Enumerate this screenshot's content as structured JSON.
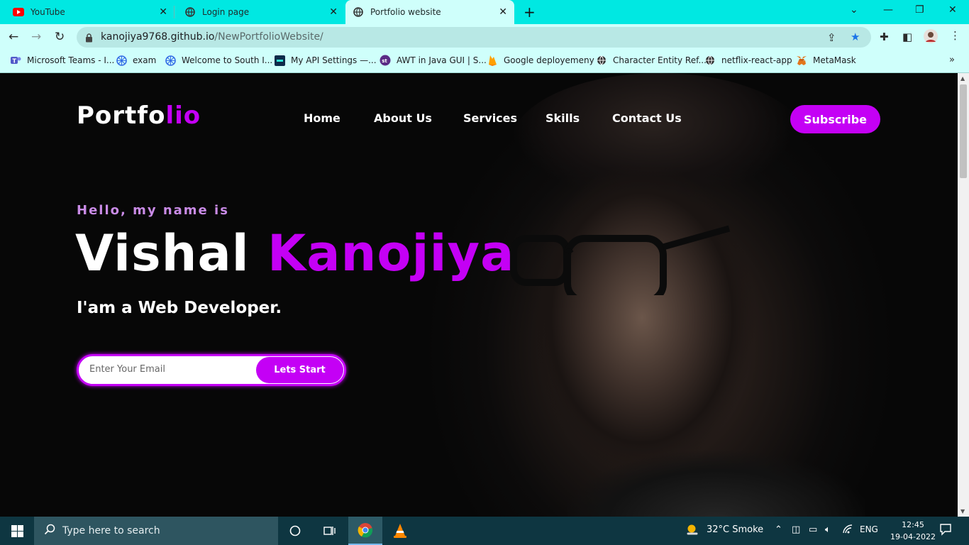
{
  "browser": {
    "tabs": [
      {
        "title": "YouTube",
        "icon": "youtube-icon"
      },
      {
        "title": "Login page",
        "icon": "globe-icon"
      },
      {
        "title": "Portfolio website",
        "icon": "globe-icon",
        "active": true
      }
    ],
    "url_host": "kanojiya9768.github.io",
    "url_path": "/NewPortfolioWebsite/",
    "bookmarks": [
      {
        "label": "Microsoft Teams - I...",
        "icon": "teams-icon"
      },
      {
        "label": "exam",
        "icon": "kubernetes-icon"
      },
      {
        "label": "Welcome to South I...",
        "icon": "kubernetes-icon"
      },
      {
        "label": "My API Settings —...",
        "icon": "api-icon"
      },
      {
        "label": "AWT in Java GUI | S...",
        "icon": "st-icon"
      },
      {
        "label": "Google deployemeny",
        "icon": "firebase-icon"
      },
      {
        "label": "Character Entity Ref...",
        "icon": "globe-icon"
      },
      {
        "label": "netflix-react-app",
        "icon": "globe-icon"
      },
      {
        "label": "MetaMask",
        "icon": "metamask-icon"
      }
    ]
  },
  "site": {
    "logo_main": "Portfo",
    "logo_accent": "lio",
    "nav": [
      "Home",
      "About Us",
      "Services",
      "Skills",
      "Contact Us"
    ],
    "subscribe": "Subscribe",
    "hello": "Hello, my name is",
    "first_name": "Vishal",
    "last_name": "Kanojiya",
    "role": "I'am a Web Developer.",
    "email_placeholder": "Enter Your Email",
    "cta": "Lets Start",
    "accent_color": "#c400f5"
  },
  "taskbar": {
    "search_placeholder": "Type here to search",
    "weather": "32°C  Smoke",
    "language": "ENG",
    "time": "12:45",
    "date": "19-04-2022"
  }
}
